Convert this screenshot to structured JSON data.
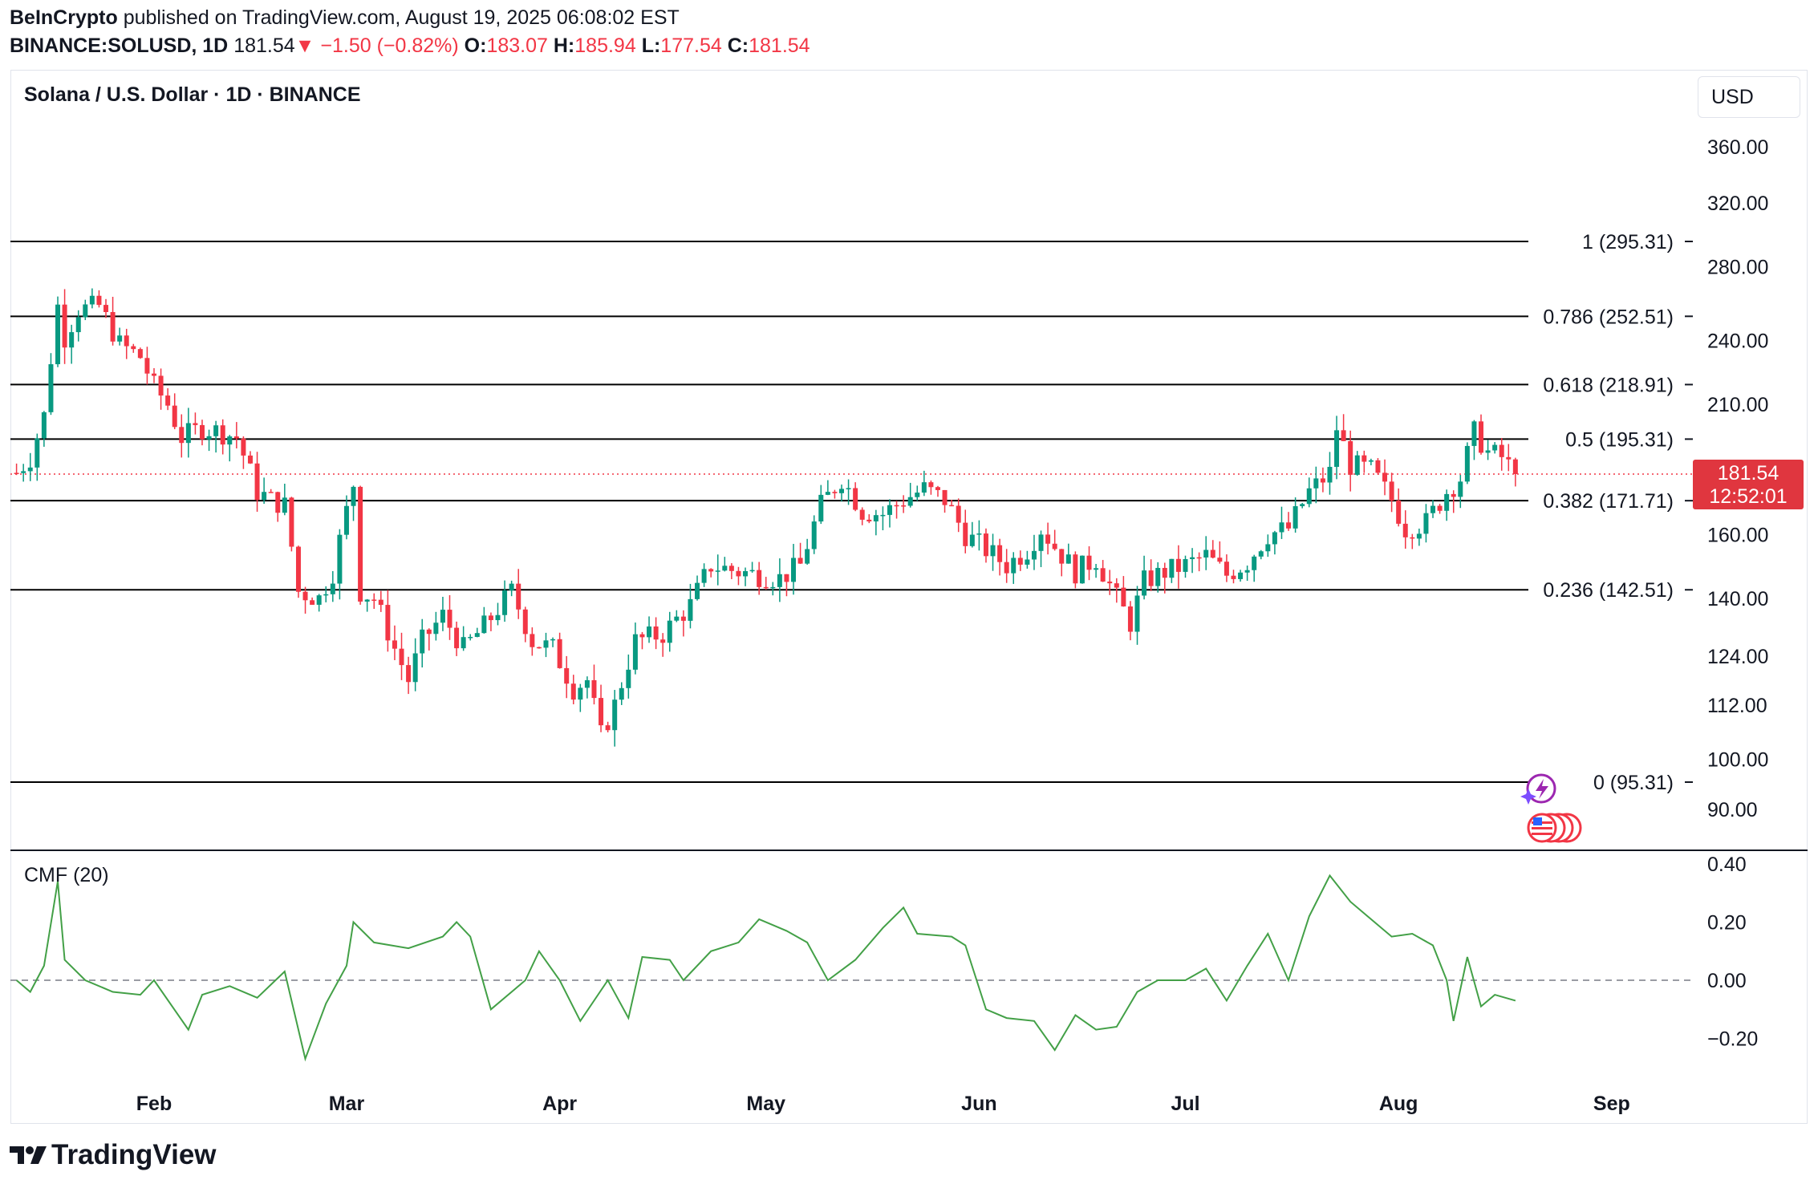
{
  "header": {
    "publisher": "BeInCrypto",
    "published_text": "published on TradingView.com, August 19, 2025 06:08:02 EST",
    "symbol": "BINANCE:SOLUSD, 1D",
    "last": "181.54",
    "change": "−1.50 (−0.82%)",
    "o_label": "O:",
    "o_value": "183.07",
    "h_label": "H:",
    "h_value": "185.94",
    "l_label": "L:",
    "l_value": "177.54",
    "c_label": "C:",
    "c_value": "181.54"
  },
  "main": {
    "title": "Solana / U.S. Dollar · 1D · BINANCE",
    "currency": "USD",
    "price_badge": {
      "price": "181.54",
      "countdown": "12:52:01"
    },
    "indicator_title": "CMF (20)",
    "logo_text": "TradingView"
  },
  "colors": {
    "up": "#089981",
    "down": "#f23645",
    "cmf": "#43a047",
    "fib_line": "#000000",
    "badge": "#e0363f"
  },
  "icons": [
    "trading-ideas-icon",
    "us-flag-events-icon",
    "tradingview-logo-icon"
  ],
  "chart_data": [
    {
      "type": "candlestick",
      "title": "Solana / U.S. Dollar · 1D · BINANCE",
      "y_scale": "log",
      "y_ticks": [
        "360.00",
        "320.00",
        "280.00",
        "240.00",
        "210.00",
        "160.00",
        "140.00",
        "124.00",
        "112.00",
        "100.00",
        "90.00"
      ],
      "x_ticks": [
        "Feb",
        "Mar",
        "Apr",
        "May",
        "Jun",
        "Jul",
        "Aug",
        "Sep"
      ],
      "fib_levels": [
        {
          "ratio": "1",
          "price": 295.31,
          "label": "1 (295.31)"
        },
        {
          "ratio": "0.786",
          "price": 252.51,
          "label": "0.786 (252.51)"
        },
        {
          "ratio": "0.618",
          "price": 218.91,
          "label": "0.618 (218.91)"
        },
        {
          "ratio": "0.5",
          "price": 195.31,
          "label": "0.5 (195.31)"
        },
        {
          "ratio": "0.382",
          "price": 171.71,
          "label": "0.382 (171.71)"
        },
        {
          "ratio": "0.236",
          "price": 142.51,
          "label": "0.236 (142.51)"
        },
        {
          "ratio": "0",
          "price": 95.31,
          "label": "0 (95.31)"
        }
      ],
      "last_price": 181.54,
      "close_path": [
        [
          "2025-01-12",
          182
        ],
        [
          "2025-01-14",
          188
        ],
        [
          "2025-01-16",
          205
        ],
        [
          "2025-01-18",
          258
        ],
        [
          "2025-01-19",
          242
        ],
        [
          "2025-01-21",
          256
        ],
        [
          "2025-01-24",
          258
        ],
        [
          "2025-01-27",
          238
        ],
        [
          "2025-01-30",
          232
        ],
        [
          "2025-02-01",
          218
        ],
        [
          "2025-02-03",
          210
        ],
        [
          "2025-02-05",
          196
        ],
        [
          "2025-02-08",
          200
        ],
        [
          "2025-02-11",
          198
        ],
        [
          "2025-02-13",
          196
        ],
        [
          "2025-02-16",
          175
        ],
        [
          "2025-02-18",
          172
        ],
        [
          "2025-02-20",
          170
        ],
        [
          "2025-02-22",
          142
        ],
        [
          "2025-02-25",
          140
        ],
        [
          "2025-02-27",
          148
        ],
        [
          "2025-03-02",
          178
        ],
        [
          "2025-03-03",
          142
        ],
        [
          "2025-03-05",
          140
        ],
        [
          "2025-03-08",
          126
        ],
        [
          "2025-03-10",
          118
        ],
        [
          "2025-03-12",
          128
        ],
        [
          "2025-03-15",
          135
        ],
        [
          "2025-03-18",
          126
        ],
        [
          "2025-03-21",
          132
        ],
        [
          "2025-03-25",
          142
        ],
        [
          "2025-03-28",
          128
        ],
        [
          "2025-03-31",
          126
        ],
        [
          "2025-04-03",
          116
        ],
        [
          "2025-04-05",
          118
        ],
        [
          "2025-04-07",
          105
        ],
        [
          "2025-04-09",
          112
        ],
        [
          "2025-04-12",
          128
        ],
        [
          "2025-04-16",
          130
        ],
        [
          "2025-04-20",
          138
        ],
        [
          "2025-04-23",
          150
        ],
        [
          "2025-04-27",
          148
        ],
        [
          "2025-04-30",
          147
        ],
        [
          "2025-05-03",
          146
        ],
        [
          "2025-05-06",
          150
        ],
        [
          "2025-05-09",
          170
        ],
        [
          "2025-05-12",
          180
        ],
        [
          "2025-05-15",
          168
        ],
        [
          "2025-05-18",
          167
        ],
        [
          "2025-05-21",
          172
        ],
        [
          "2025-05-24",
          176
        ],
        [
          "2025-05-27",
          172
        ],
        [
          "2025-05-30",
          160
        ],
        [
          "2025-06-02",
          155
        ],
        [
          "2025-06-05",
          150
        ],
        [
          "2025-06-08",
          155
        ],
        [
          "2025-06-10",
          162
        ],
        [
          "2025-06-12",
          156
        ],
        [
          "2025-06-15",
          148
        ],
        [
          "2025-06-18",
          152
        ],
        [
          "2025-06-21",
          140
        ],
        [
          "2025-06-23",
          133
        ],
        [
          "2025-06-25",
          145
        ],
        [
          "2025-06-28",
          148
        ],
        [
          "2025-07-01",
          150
        ],
        [
          "2025-07-04",
          153
        ],
        [
          "2025-07-07",
          147
        ],
        [
          "2025-07-10",
          151
        ],
        [
          "2025-07-13",
          160
        ],
        [
          "2025-07-16",
          162
        ],
        [
          "2025-07-19",
          175
        ],
        [
          "2025-07-22",
          182
        ],
        [
          "2025-07-23",
          200
        ],
        [
          "2025-07-25",
          185
        ],
        [
          "2025-07-28",
          183
        ],
        [
          "2025-07-31",
          172
        ],
        [
          "2025-08-02",
          162
        ],
        [
          "2025-08-05",
          164
        ],
        [
          "2025-08-08",
          175
        ],
        [
          "2025-08-10",
          180
        ],
        [
          "2025-08-12",
          198
        ],
        [
          "2025-08-14",
          190
        ],
        [
          "2025-08-16",
          188
        ],
        [
          "2025-08-18",
          181.54
        ]
      ]
    },
    {
      "type": "line",
      "title": "CMF (20)",
      "y_ticks": [
        "0.40",
        "0.20",
        "0.00",
        "−0.20"
      ],
      "reference_line": 0,
      "series": [
        {
          "values_path": [
            [
              "2025-01-12",
              0.0
            ],
            [
              "2025-01-14",
              -0.04
            ],
            [
              "2025-01-16",
              0.05
            ],
            [
              "2025-01-18",
              0.34
            ],
            [
              "2025-01-19",
              0.07
            ],
            [
              "2025-01-22",
              0.0
            ],
            [
              "2025-01-26",
              -0.04
            ],
            [
              "2025-01-30",
              -0.05
            ],
            [
              "2025-02-01",
              0.0
            ],
            [
              "2025-02-06",
              -0.17
            ],
            [
              "2025-02-08",
              -0.05
            ],
            [
              "2025-02-12",
              -0.02
            ],
            [
              "2025-02-16",
              -0.06
            ],
            [
              "2025-02-20",
              0.03
            ],
            [
              "2025-02-23",
              -0.27
            ],
            [
              "2025-02-26",
              -0.08
            ],
            [
              "2025-03-01",
              0.05
            ],
            [
              "2025-03-02",
              0.2
            ],
            [
              "2025-03-05",
              0.13
            ],
            [
              "2025-03-10",
              0.11
            ],
            [
              "2025-03-15",
              0.15
            ],
            [
              "2025-03-17",
              0.2
            ],
            [
              "2025-03-19",
              0.15
            ],
            [
              "2025-03-22",
              -0.1
            ],
            [
              "2025-03-27",
              0.0
            ],
            [
              "2025-03-29",
              0.1
            ],
            [
              "2025-04-01",
              0.0
            ],
            [
              "2025-04-04",
              -0.14
            ],
            [
              "2025-04-08",
              0.0
            ],
            [
              "2025-04-11",
              -0.13
            ],
            [
              "2025-04-13",
              0.08
            ],
            [
              "2025-04-17",
              0.07
            ],
            [
              "2025-04-19",
              0.0
            ],
            [
              "2025-04-23",
              0.1
            ],
            [
              "2025-04-27",
              0.13
            ],
            [
              "2025-04-30",
              0.21
            ],
            [
              "2025-05-04",
              0.17
            ],
            [
              "2025-05-07",
              0.13
            ],
            [
              "2025-05-10",
              0.0
            ],
            [
              "2025-05-14",
              0.07
            ],
            [
              "2025-05-18",
              0.18
            ],
            [
              "2025-05-21",
              0.25
            ],
            [
              "2025-05-23",
              0.16
            ],
            [
              "2025-05-28",
              0.15
            ],
            [
              "2025-05-30",
              0.12
            ],
            [
              "2025-06-02",
              -0.1
            ],
            [
              "2025-06-05",
              -0.13
            ],
            [
              "2025-06-09",
              -0.14
            ],
            [
              "2025-06-12",
              -0.24
            ],
            [
              "2025-06-15",
              -0.12
            ],
            [
              "2025-06-18",
              -0.17
            ],
            [
              "2025-06-21",
              -0.16
            ],
            [
              "2025-06-24",
              -0.04
            ],
            [
              "2025-06-27",
              0.0
            ],
            [
              "2025-07-01",
              0.0
            ],
            [
              "2025-07-04",
              0.04
            ],
            [
              "2025-07-07",
              -0.07
            ],
            [
              "2025-07-10",
              0.05
            ],
            [
              "2025-07-13",
              0.16
            ],
            [
              "2025-07-16",
              0.0
            ],
            [
              "2025-07-19",
              0.22
            ],
            [
              "2025-07-22",
              0.36
            ],
            [
              "2025-07-25",
              0.27
            ],
            [
              "2025-07-28",
              0.21
            ],
            [
              "2025-07-31",
              0.15
            ],
            [
              "2025-08-03",
              0.16
            ],
            [
              "2025-08-06",
              0.12
            ],
            [
              "2025-08-08",
              0.0
            ],
            [
              "2025-08-09",
              -0.14
            ],
            [
              "2025-08-11",
              0.08
            ],
            [
              "2025-08-13",
              -0.09
            ],
            [
              "2025-08-15",
              -0.05
            ],
            [
              "2025-08-18",
              -0.07
            ]
          ]
        }
      ]
    }
  ]
}
